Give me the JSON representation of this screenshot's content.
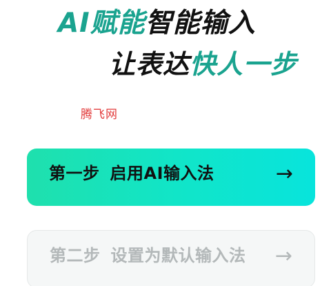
{
  "hero": {
    "line1": {
      "accent": "AI赋能",
      "dark": "智能输入"
    },
    "line2": {
      "dark": "让表达",
      "accent": "快人一步"
    }
  },
  "watermark": "腾飞网",
  "steps": [
    {
      "prefix": "第一步",
      "label": "启用AI输入法",
      "arrow": "→",
      "state": "active"
    },
    {
      "prefix": "第二步",
      "label": "设置为默认输入法",
      "arrow": "→",
      "state": "disabled"
    }
  ],
  "colors": {
    "accent": "#1aa38f",
    "active_gradient_start": "#1fe0ad",
    "active_gradient_end": "#08e4dc",
    "disabled_bg": "#f5f7f7",
    "disabled_text": "#b3b8b9",
    "dark_text": "#111111",
    "watermark": "#e23a3a"
  },
  "icons": {
    "step_arrow": "arrow-right-icon"
  }
}
